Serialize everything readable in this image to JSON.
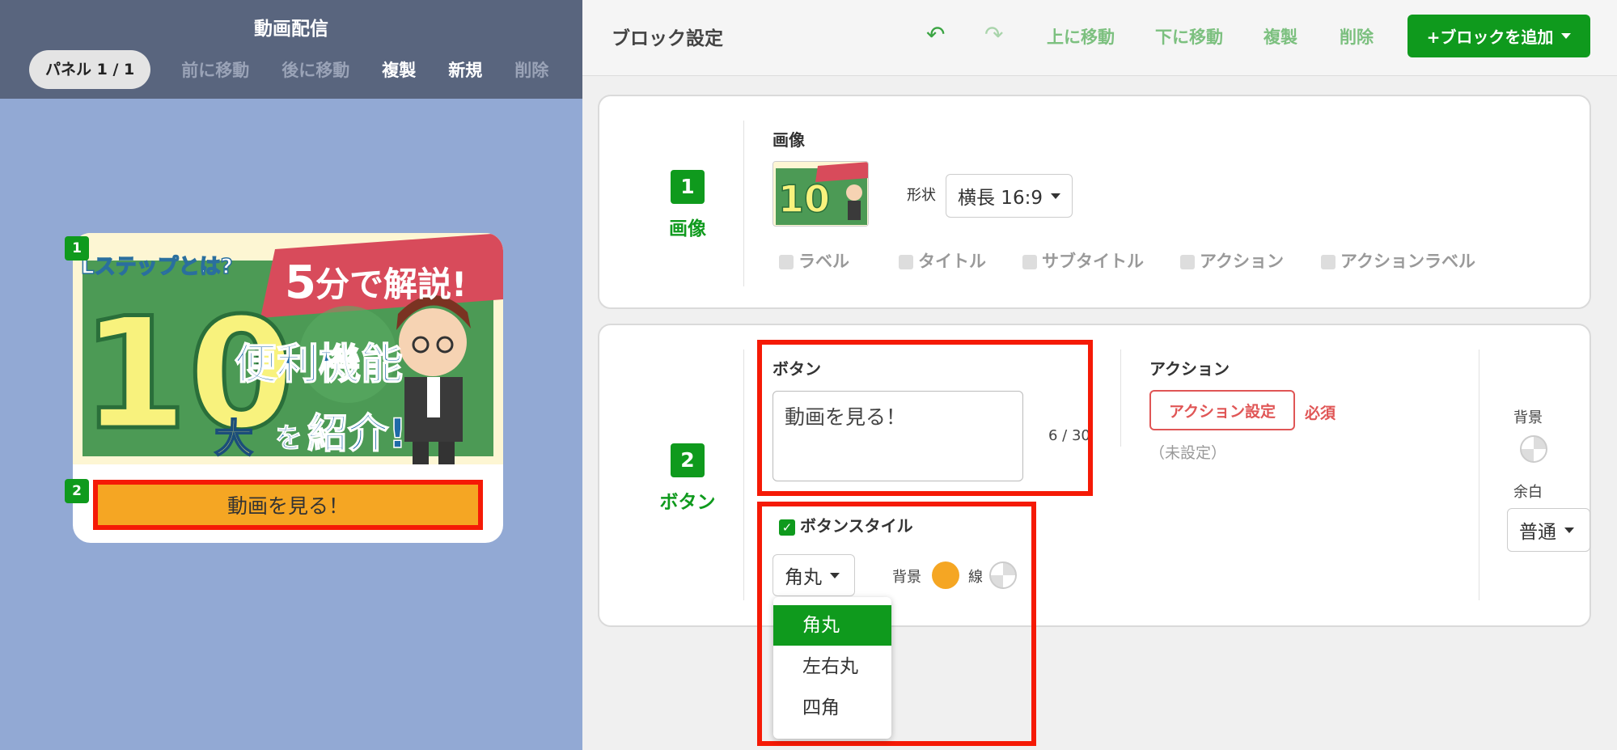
{
  "left": {
    "title": "動画配信",
    "panel_pill": "パネル 1 / 1",
    "toolbar": [
      "前に移動",
      "後に移動",
      "複製",
      "新規",
      "削除"
    ],
    "toolbar_active": [
      false,
      false,
      true,
      true,
      false
    ],
    "card": {
      "badge1": "1",
      "badge2": "2",
      "banner": {
        "logo": "Lステップとは?",
        "ribbon_num": "5",
        "ribbon_text": "分で解説!",
        "big_num": "10",
        "big_kanji": "大",
        "line1": "便利機能",
        "line2_pre": "を",
        "line2": "紹介!"
      },
      "button_label": "動画を見る！"
    }
  },
  "right": {
    "title": "ブロック設定",
    "undo_icon": "undo-icon",
    "redo_icon": "redo-icon",
    "actions": [
      "上に移動",
      "下に移動",
      "複製",
      "削除"
    ],
    "add_block": "+ブロックを追加",
    "block1": {
      "num": "1",
      "label": "画像",
      "field_label": "画像",
      "shape_label": "形状",
      "shape_value": "横長 16:9",
      "checkboxes": [
        "ラベル",
        "タイトル",
        "サブタイトル",
        "アクション",
        "アクションラベル"
      ]
    },
    "block2": {
      "num": "2",
      "label": "ボタン",
      "button_label": "ボタン",
      "button_value": "動画を見る！",
      "char_count": "6 / 30",
      "action_label": "アクション",
      "action_button": "アクション設定",
      "required": "必須",
      "unset": "（未設定）",
      "bg_label": "背景",
      "margin_label": "余白",
      "margin_value": "普通",
      "style_label": "ボタンスタイル",
      "style_value": "角丸",
      "style_bg_label": "背景",
      "style_line_label": "線",
      "style_bg_color": "#f5a623",
      "dropdown": [
        "角丸",
        "左右丸",
        "四角"
      ],
      "dropdown_selected": "角丸"
    }
  },
  "colors": {
    "accent": "#0f9a1d",
    "highlight": "#f51a06",
    "button_orange": "#f5a623",
    "left_bg": "#92a9d4",
    "left_header": "#59657e"
  }
}
